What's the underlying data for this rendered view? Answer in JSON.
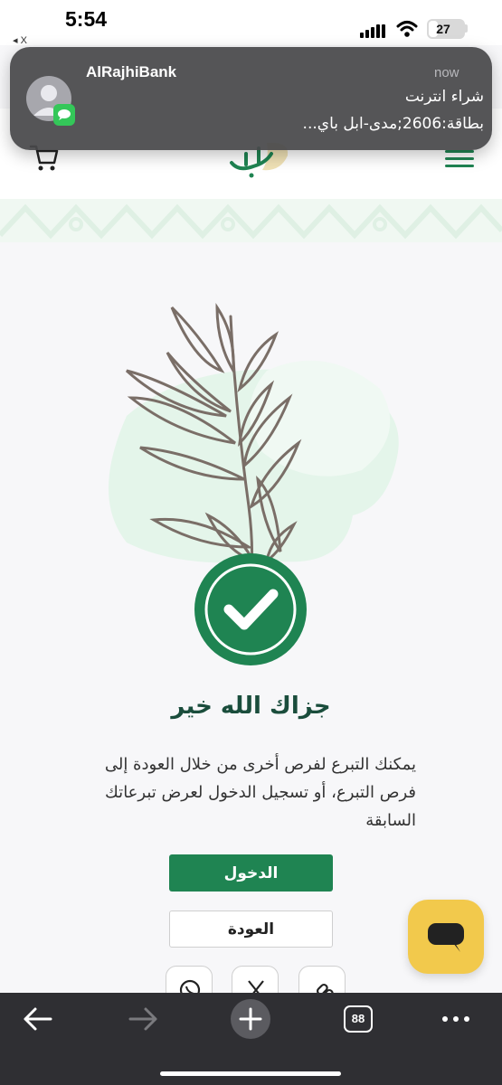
{
  "status_bar": {
    "time": "5:54",
    "back_app_label": "◂ X",
    "battery_level": "27"
  },
  "notification": {
    "app_name": "AlRajhiBank",
    "time": "now",
    "line1": "شراء انترنت",
    "line2": "بطاقة:2606;مدى-ابل باي..."
  },
  "header": {
    "cart_icon": "cart-icon",
    "menu_icon": "hamburger-menu-icon",
    "logo_icon": "logo-icon"
  },
  "main": {
    "title": "جزاك الله خير",
    "body": "يمكنك التبرع لفرص أخرى من خلال العودة إلى فرص التبرع، أو تسجيل الدخول لعرض تبرعاتك السابقة",
    "login_label": "الدخول",
    "back_label": "العودة"
  },
  "share": {
    "icons": [
      "whatsapp-icon",
      "x-icon",
      "link-icon"
    ]
  },
  "browser": {
    "tab_count": "88"
  },
  "colors": {
    "primary_green": "#1f8452",
    "dark_green": "#1a4d3c",
    "light_green": "#e4f5ea",
    "chat_yellow": "#f2c94c",
    "browser_bar": "#2f2f33"
  }
}
